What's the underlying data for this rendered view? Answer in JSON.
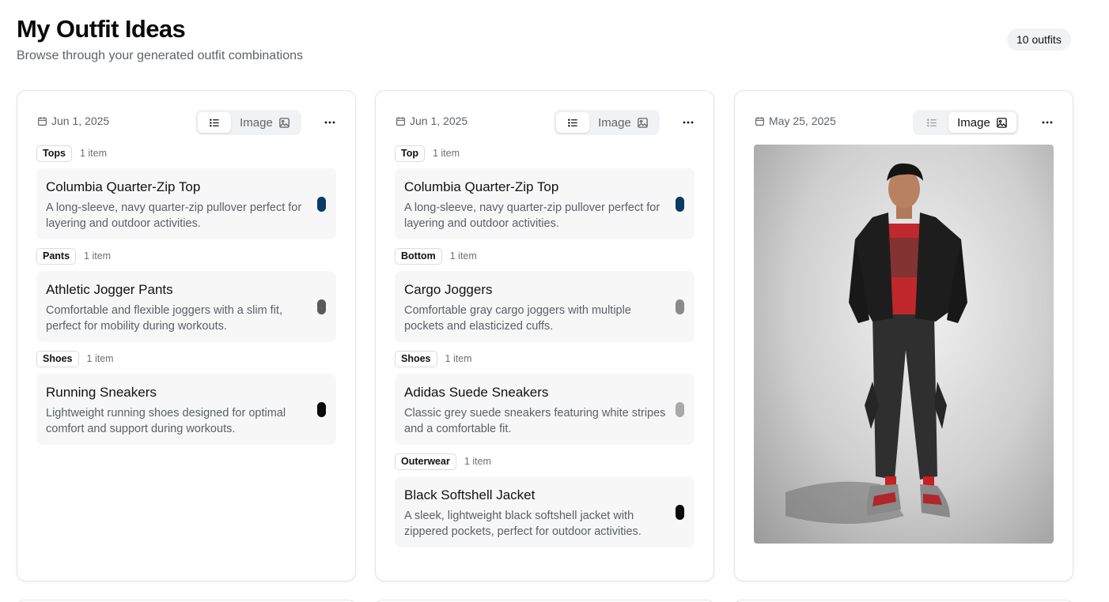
{
  "header": {
    "title": "My Outfit Ideas",
    "subtitle": "Browse through your generated outfit combinations",
    "count_badge": "10 outfits"
  },
  "cards": [
    {
      "date": "Jun 1, 2025",
      "view_toggle": {
        "image_label": "Image",
        "active": "list"
      },
      "sections": [
        {
          "category": "Tops",
          "count": "1 item",
          "item": {
            "name": "Columbia Quarter-Zip Top",
            "description": "A long-sleeve, navy quarter-zip pullover perfect for layering and outdoor activities.",
            "color": "#0b3a63"
          }
        },
        {
          "category": "Pants",
          "count": "1 item",
          "item": {
            "name": "Athletic Jogger Pants",
            "description": "Comfortable and flexible joggers with a slim fit, perfect for mobility during workouts.",
            "color": "#5a5a5a"
          }
        },
        {
          "category": "Shoes",
          "count": "1 item",
          "item": {
            "name": "Running Sneakers",
            "description": "Lightweight running shoes designed for optimal comfort and support during workouts.",
            "color": "#0a0a0a"
          }
        }
      ]
    },
    {
      "date": "Jun 1, 2025",
      "view_toggle": {
        "image_label": "Image",
        "active": "list"
      },
      "sections": [
        {
          "category": "Top",
          "count": "1 item",
          "item": {
            "name": "Columbia Quarter-Zip Top",
            "description": "A long-sleeve, navy quarter-zip pullover perfect for layering and outdoor activities.",
            "color": "#0b3a63"
          }
        },
        {
          "category": "Bottom",
          "count": "1 item",
          "item": {
            "name": "Cargo Joggers",
            "description": "Comfortable gray cargo joggers with multiple pockets and elasticized cuffs.",
            "color": "#8a8a8a"
          }
        },
        {
          "category": "Shoes",
          "count": "1 item",
          "item": {
            "name": "Adidas Suede Sneakers",
            "description": "Classic grey suede sneakers featuring white stripes and a comfortable fit.",
            "color": "#a9a9a9"
          }
        },
        {
          "category": "Outerwear",
          "count": "1 item",
          "item": {
            "name": "Black Softshell Jacket",
            "description": "A sleek, lightweight black softshell jacket with zippered pockets, perfect for outdoor activities.",
            "color": "#0a0a0a"
          }
        }
      ]
    },
    {
      "date": "May 25, 2025",
      "view_toggle": {
        "image_label": "Image",
        "active": "image"
      },
      "image": {
        "subject": "full-body photo of model wearing black denim jacket, red graphic tee, striped black cargo pants and red-grey sneakers"
      }
    }
  ],
  "icons": {
    "date": "calendar-icon",
    "list_view": "list-icon",
    "image_view": "image-icon",
    "menu": "more-horizontal-icon"
  }
}
